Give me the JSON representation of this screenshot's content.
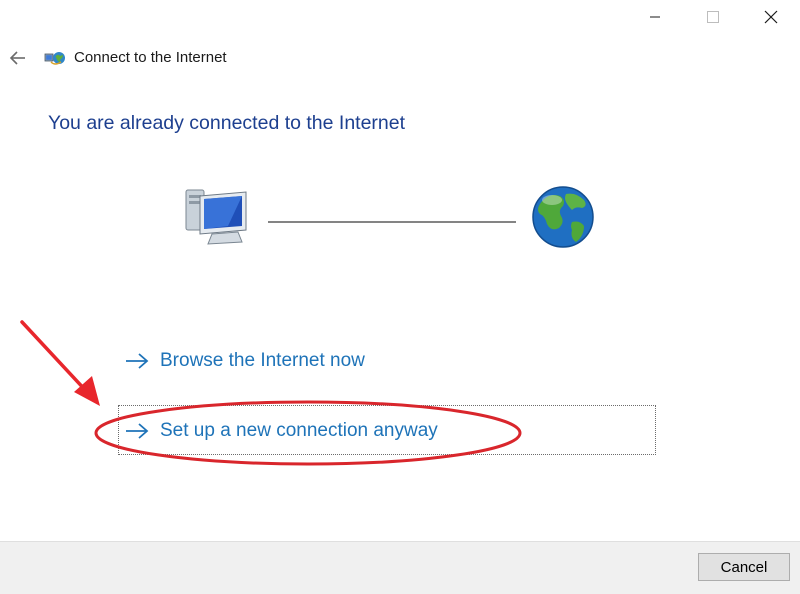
{
  "window": {
    "minimize_icon": "minimize-icon",
    "maximize_icon": "maximize-icon",
    "close_icon": "close-icon"
  },
  "header": {
    "back_icon": "back-arrow-icon",
    "app_icon": "network-globe-icon",
    "title": "Connect to the Internet"
  },
  "main": {
    "heading": "You are already connected to the Internet",
    "diagram": {
      "left_icon": "computer-icon",
      "right_icon": "globe-icon"
    },
    "options": [
      {
        "label": "Browse the Internet now",
        "icon": "arrow-right-icon"
      },
      {
        "label": "Set up a new connection anyway",
        "icon": "arrow-right-icon",
        "focused": true
      }
    ]
  },
  "footer": {
    "cancel_label": "Cancel"
  },
  "annotations": {
    "callout_arrow_color": "#e8262c",
    "highlight_ellipse_color": "#d9262c"
  },
  "colors": {
    "heading": "#1d3f8f",
    "link": "#1e73b8"
  }
}
